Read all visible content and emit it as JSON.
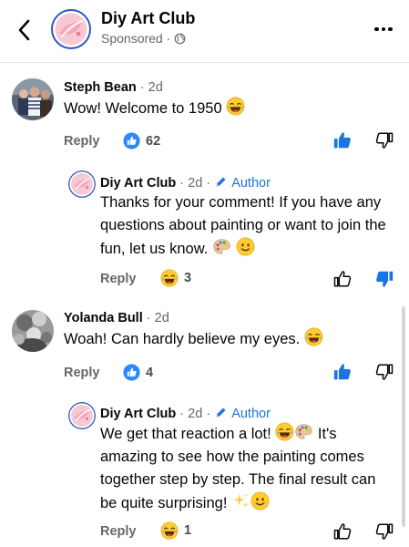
{
  "header": {
    "page_name": "Diy Art Club",
    "sponsored": "Sponsored ·",
    "icons": {
      "back": "chevron-left-icon",
      "globe": "globe-icon",
      "more": "more-horizontal-icon"
    }
  },
  "comments": [
    {
      "author": "Steph Bean",
      "time": "· 2d",
      "text": "Wow! Welcome to 1950",
      "reply_label": "Reply",
      "reaction_count": "62",
      "reaction_type": "like",
      "reply": {
        "author": "Diy Art Club",
        "time": "· 2d ·",
        "author_badge": "Author",
        "text": "Thanks for your comment! If you have any questions about painting or want to join the fun, let us know.",
        "reply_label": "Reply",
        "reaction_count": "3",
        "reaction_type": "haha"
      }
    },
    {
      "author": "Yolanda Bull",
      "time": "· 2d",
      "text": "Woah! Can hardly believe my eyes.",
      "reply_label": "Reply",
      "reaction_count": "4",
      "reaction_type": "like",
      "reply": {
        "author": "Diy Art Club",
        "time": "· 2d ·",
        "author_badge": "Author",
        "text_part1": "We get that reaction a lot!",
        "text_part2": "It's amazing to see how the painting comes together step by step. The final result can be quite surprising!",
        "reply_label": "Reply",
        "reaction_count": "1",
        "reaction_type": "haha"
      }
    }
  ],
  "colors": {
    "accent": "#1b74e4",
    "muted": "#65676b",
    "text": "#050505",
    "divider": "#e4e6eb"
  }
}
